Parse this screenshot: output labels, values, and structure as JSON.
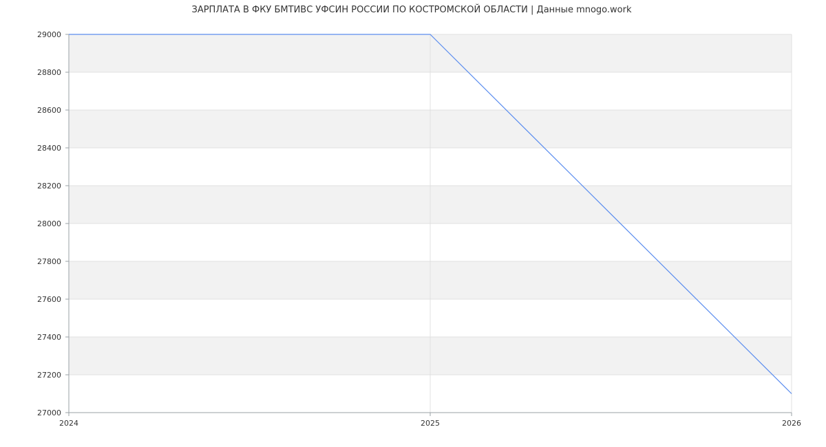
{
  "chart_data": {
    "type": "line",
    "title": "ЗАРПЛАТА В ФКУ БМТИВС УФСИН РОССИИ ПО КОСТРОМСКОЙ ОБЛАСТИ | Данные mnogo.work",
    "xlabel": "",
    "ylabel": "",
    "x": [
      2024,
      2025,
      2026
    ],
    "x_ticks": [
      "2024",
      "2025",
      "2026"
    ],
    "xlim": [
      2024,
      2026
    ],
    "ylim": [
      27000,
      29000
    ],
    "y_ticks": [
      27000,
      27200,
      27400,
      27600,
      27800,
      28000,
      28200,
      28400,
      28600,
      28800,
      29000
    ],
    "grid": true,
    "legend": "none",
    "series": [
      {
        "values": [
          29000,
          29000,
          27100
        ],
        "color": "#5b8def"
      }
    ],
    "band_color": "#f2f2f2",
    "grid_color": "#e0e0e0",
    "axis_color": "#9aa0a6"
  }
}
